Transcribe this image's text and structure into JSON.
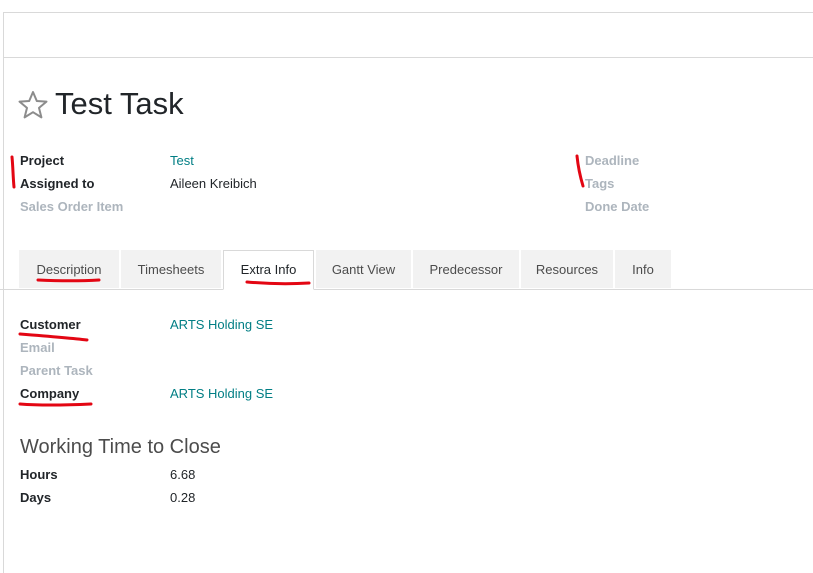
{
  "task": {
    "title": "Test Task"
  },
  "header_fields": {
    "project": {
      "label": "Project",
      "value": "Test"
    },
    "assigned_to": {
      "label": "Assigned to",
      "value": "Aileen Kreibich"
    },
    "sales_order_item": {
      "label": "Sales Order Item",
      "value": ""
    },
    "deadline": {
      "label": "Deadline",
      "value": ""
    },
    "tags": {
      "label": "Tags",
      "value": ""
    },
    "done_date": {
      "label": "Done Date",
      "value": ""
    }
  },
  "tabs": [
    {
      "label": "Description",
      "active": false
    },
    {
      "label": "Timesheets",
      "active": false
    },
    {
      "label": "Extra Info",
      "active": true
    },
    {
      "label": "Gantt View",
      "active": false
    },
    {
      "label": "Predecessor",
      "active": false
    },
    {
      "label": "Resources",
      "active": false
    },
    {
      "label": "Info",
      "active": false
    }
  ],
  "extra_info": {
    "customer": {
      "label": "Customer",
      "value": "ARTS Holding SE"
    },
    "email": {
      "label": "Email",
      "value": ""
    },
    "parent_task": {
      "label": "Parent Task",
      "value": ""
    },
    "company": {
      "label": "Company",
      "value": "ARTS Holding SE"
    }
  },
  "working_time": {
    "title": "Working Time to Close",
    "hours": {
      "label": "Hours",
      "value": "6.68"
    },
    "days": {
      "label": "Days",
      "value": "0.28"
    }
  },
  "colors": {
    "link": "#017e84",
    "muted_label": "#adb5bd",
    "annotation": "#e30613"
  },
  "icons": {
    "favorite": "star-outline-icon"
  }
}
